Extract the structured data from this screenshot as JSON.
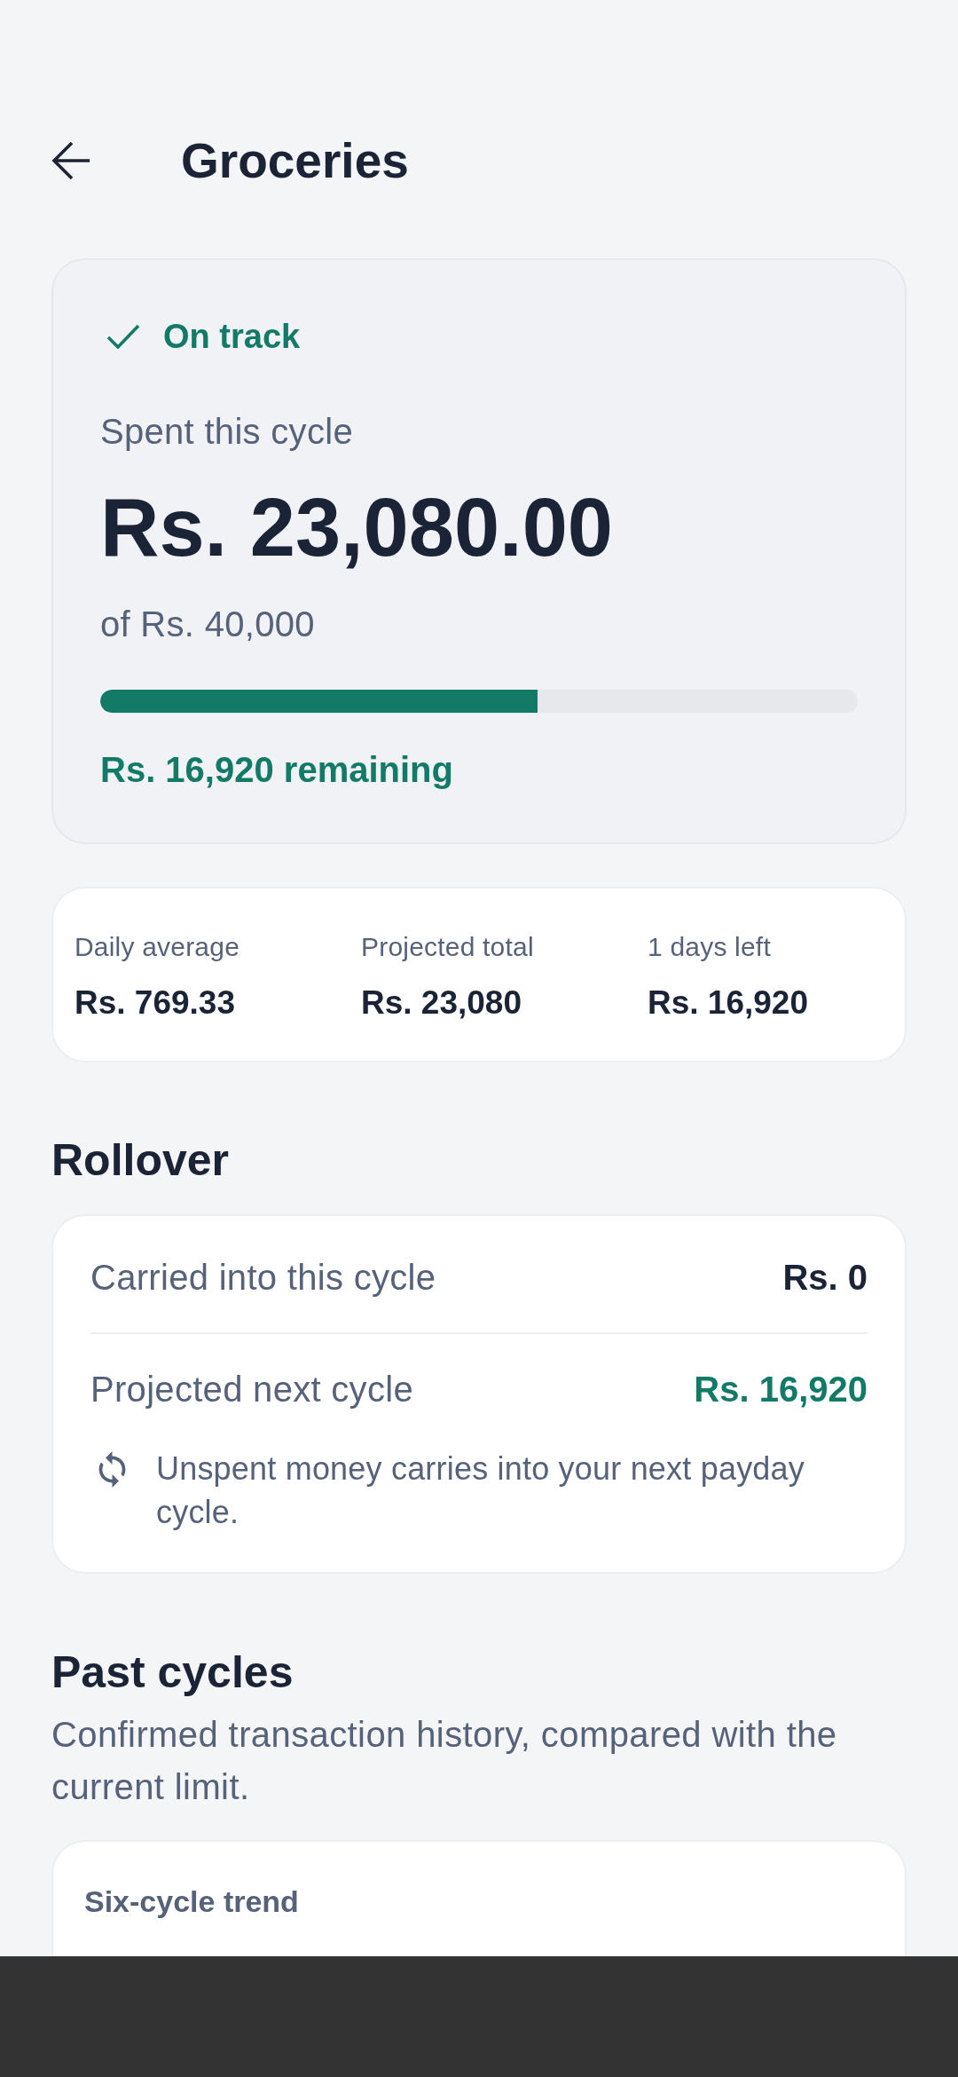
{
  "header": {
    "title": "Groceries"
  },
  "status_card": {
    "status": {
      "label": "On track",
      "on_track": true
    },
    "spent_label": "Spent this cycle",
    "spent_amount": "Rs. 23,080.00",
    "limit": "of Rs. 40,000",
    "progress": {
      "level": 0.577
    },
    "remaining": "Rs. 16,920 remaining"
  },
  "stats": [
    {
      "label": "Daily average",
      "value": "Rs. 769.33"
    },
    {
      "label": "Projected total",
      "value": "Rs. 23,080"
    },
    {
      "label": "1 days left",
      "value": "Rs. 16,920"
    }
  ],
  "rollover": {
    "title": "Rollover",
    "rows": [
      {
        "label": "Carried into this cycle",
        "value": "Rs. 0",
        "highlight": false
      },
      {
        "label": "Projected next cycle",
        "value": "Rs. 16,920",
        "highlight": true
      }
    ],
    "note": "Unspent money carries into your next payday cycle."
  },
  "past_cycles": {
    "title": "Past cycles",
    "subtitle": "Confirmed transaction history, compared with the current limit.",
    "chart_card": {
      "title": "Six-cycle trend"
    }
  }
}
